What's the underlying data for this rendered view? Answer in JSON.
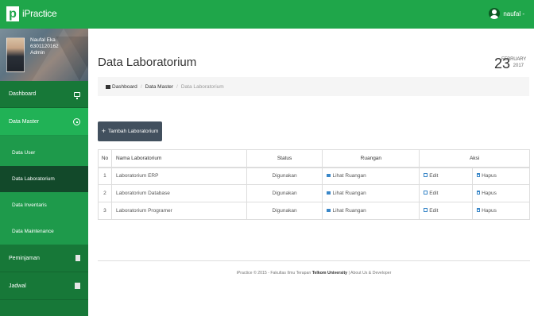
{
  "app": {
    "logo_letter": "p",
    "brand": "iPractice"
  },
  "user_menu": {
    "name": "naufal -"
  },
  "profile": {
    "name": "Naufal Eka",
    "id": "6301120162",
    "role": "Admin"
  },
  "sidebar": {
    "dashboard": "Dashboard",
    "data_master": "Data Master",
    "sub_items": [
      "Data User",
      "Data Laboratorium",
      "Data Inventaris",
      "Data Maintenance"
    ],
    "peminjaman": "Peminjaman",
    "jadwal": "Jadwal"
  },
  "page": {
    "title": "Data Laboratorium"
  },
  "date": {
    "day": "23",
    "month": "FEBRUARY",
    "year": "2017"
  },
  "breadcrumb": {
    "home": "Dashboard",
    "master": "Data Master",
    "current": "Data Laboratorium"
  },
  "actions": {
    "add_label": "Tambah Laboratorium"
  },
  "table": {
    "headers": {
      "no": "No",
      "name": "Nama Laboratorium",
      "status": "Status",
      "ruangan": "Ruangan",
      "aksi": "Aksi"
    },
    "rows": [
      {
        "no": "1",
        "name": "Laboratorium ERP",
        "status": "Digunakan",
        "ruangan": "Lihat Ruangan",
        "edit": "Edit",
        "hapus": "Hapus"
      },
      {
        "no": "2",
        "name": "Laboratorium Database",
        "status": "Digunakan",
        "ruangan": "Lihat Ruangan",
        "edit": "Edit",
        "hapus": "Hapus"
      },
      {
        "no": "3",
        "name": "Laboratorium Programer",
        "status": "Digunakan",
        "ruangan": "Lihat Ruangan",
        "edit": "Edit",
        "hapus": "Hapus"
      }
    ]
  },
  "footer": {
    "prefix": "iPractice © 2015 - Fakultas Ilmu Terapan ",
    "university": "Telkom University",
    "suffix": " | About Us & Developer"
  },
  "colors": {
    "topbar": "#1fa64a",
    "sidebar": "#177838",
    "active_nav": "#21b256",
    "link": "#3a87c8",
    "button": "#42505e"
  }
}
